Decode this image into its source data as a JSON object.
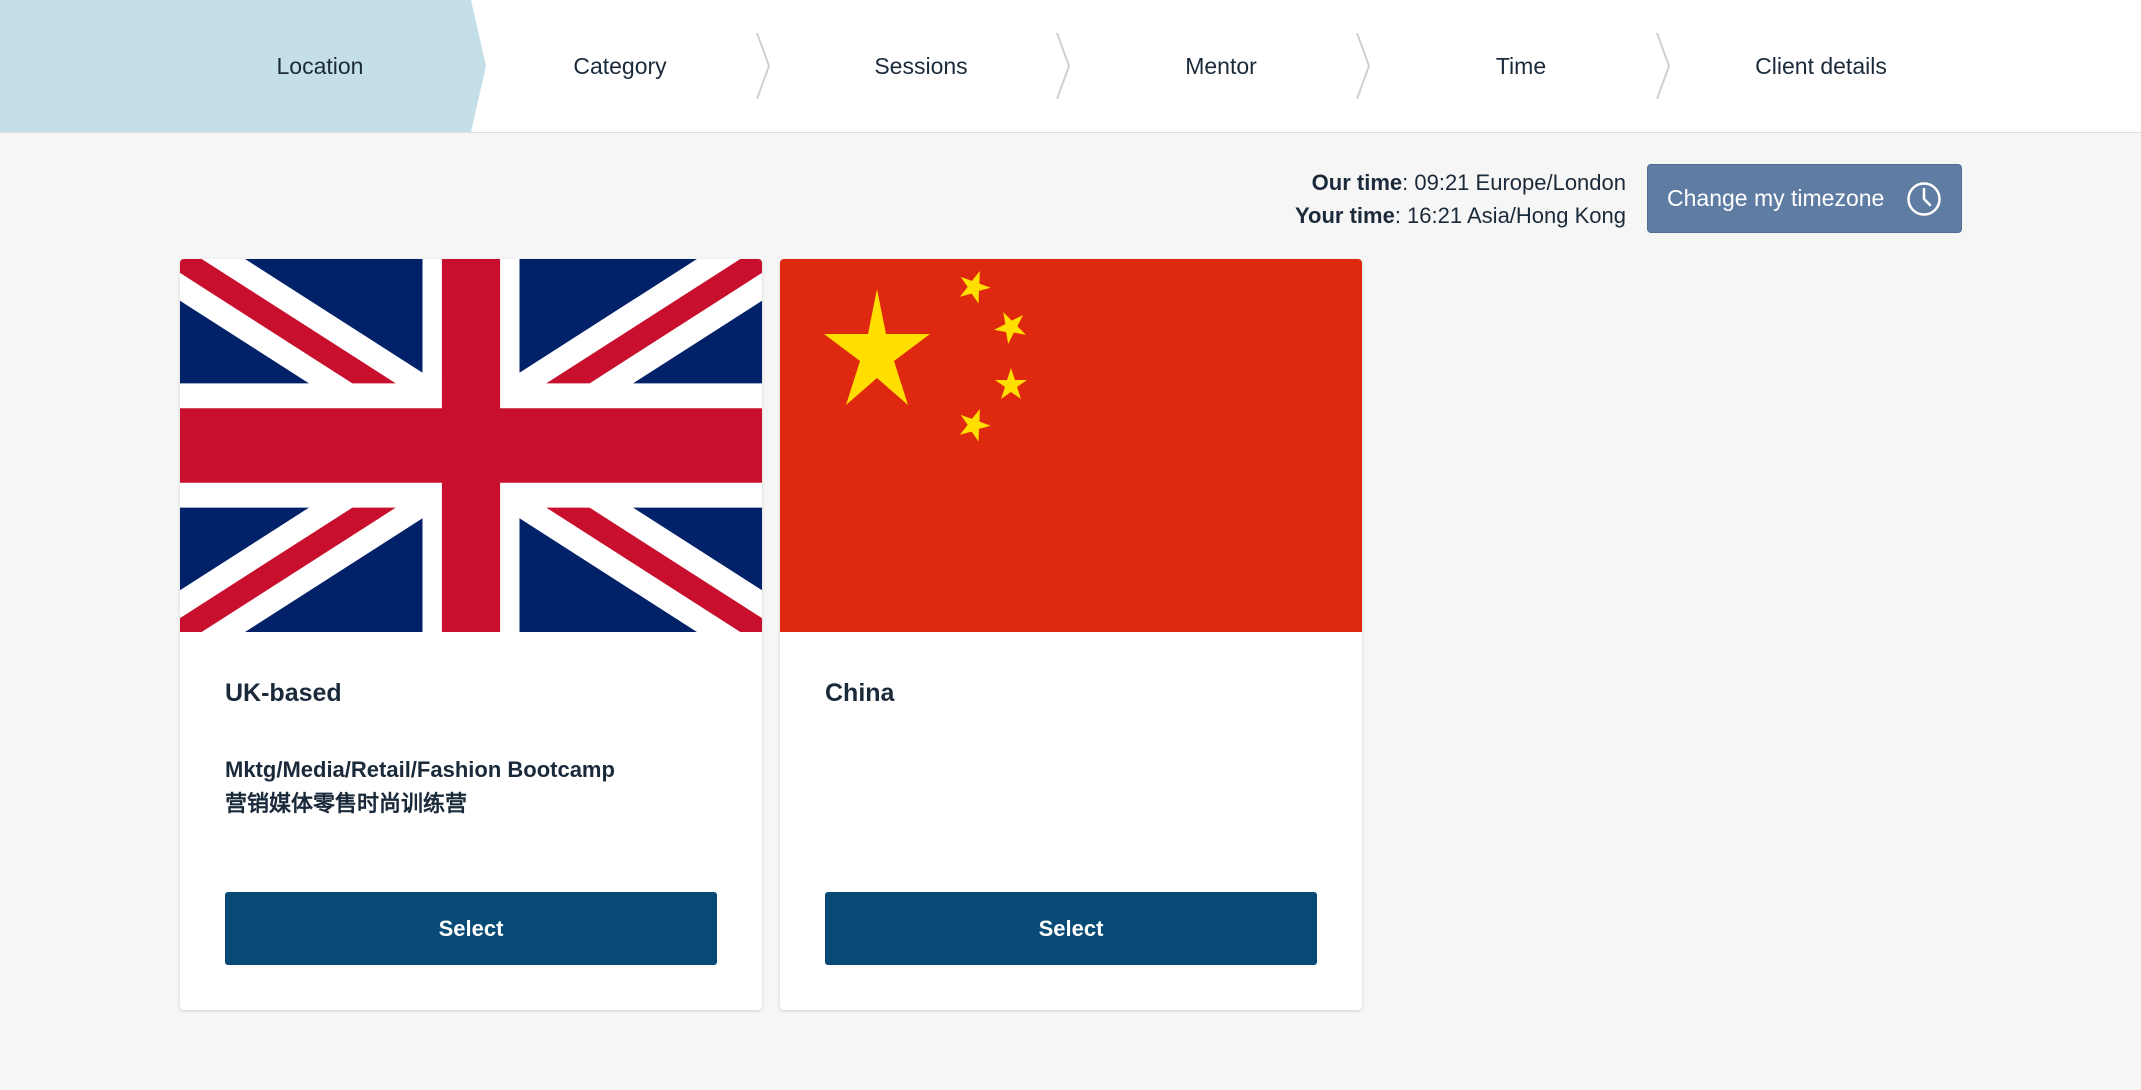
{
  "stepper": {
    "steps": [
      {
        "label": "Location",
        "active": true
      },
      {
        "label": "Category",
        "active": false
      },
      {
        "label": "Sessions",
        "active": false
      },
      {
        "label": "Mentor",
        "active": false
      },
      {
        "label": "Time",
        "active": false
      },
      {
        "label": "Client details",
        "active": false
      }
    ]
  },
  "time_info": {
    "our_label": "Our time",
    "our_value": ": 09:21 Europe/London",
    "your_label": "Your time",
    "your_value": ": 16:21 Asia/Hong Kong",
    "change_button": "Change my timezone",
    "change_icon": "clock-icon"
  },
  "cards": [
    {
      "flag": "uk-flag",
      "title": "UK-based",
      "desc_line1": "Mktg/Media/Retail/Fashion Bootcamp",
      "desc_line2": "营销媒体零售时尚训练营",
      "button": "Select"
    },
    {
      "flag": "china-flag",
      "title": "China",
      "desc_line1": "",
      "desc_line2": "",
      "button": "Select"
    }
  ],
  "colors": {
    "active_step": "#c5dfe8",
    "primary_button": "#064a75",
    "timezone_button": "#5f7ca3",
    "background": "#f6f6f6",
    "uk_blue": "#012169",
    "uk_red": "#C8102E",
    "china_red": "#DE2910",
    "china_yellow": "#FFDE00"
  }
}
